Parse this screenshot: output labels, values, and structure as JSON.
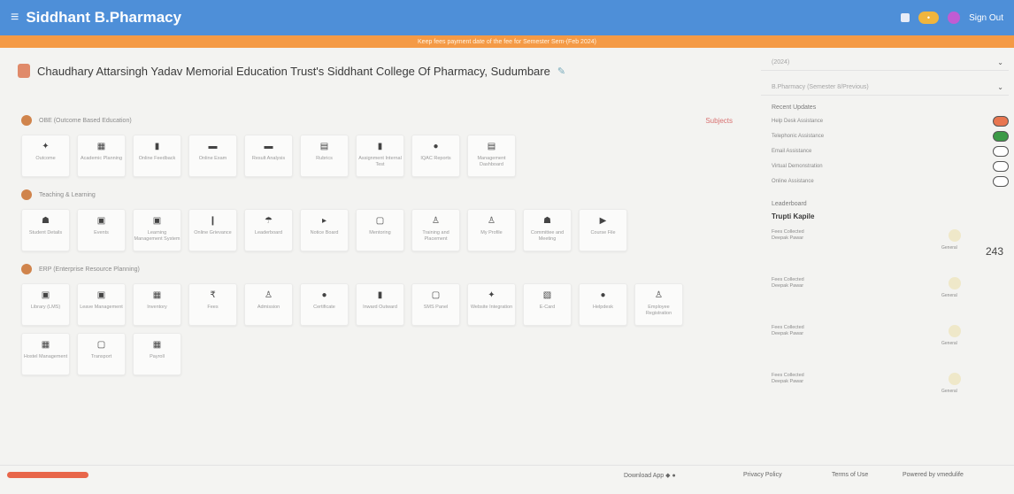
{
  "topbar": {
    "menu_icon": "hamburger-icon",
    "app_name": "Siddhant B.Pharmacy",
    "sign_out": "Sign Out",
    "colors": {
      "bar": "#4e8fd8",
      "banner": "#f49a46"
    }
  },
  "banner": {
    "text": "Keep fees payment date of the fee for Semester Sem-(Feb 2024)"
  },
  "page": {
    "title": "Chaudhary Attarsingh Yadav Memorial Education Trust's Siddhant College Of Pharmacy, Sudumbare",
    "description": ""
  },
  "sections": [
    {
      "title": "OBE (Outcome Based Education)",
      "link": "Subjects",
      "tiles": [
        {
          "label": "Outcome",
          "icon": "✦"
        },
        {
          "label": "Academic Planning",
          "icon": "▦"
        },
        {
          "label": "Online Feedback",
          "icon": "▮"
        },
        {
          "label": "Online Exam",
          "icon": "▬"
        },
        {
          "label": "Result Analysis",
          "icon": "▬"
        },
        {
          "label": "Rubrics",
          "icon": "▤"
        },
        {
          "label": "Assignment Internal Test",
          "icon": "▮"
        },
        {
          "label": "IQAC Reports",
          "icon": "●"
        },
        {
          "label": "Management Dashboard",
          "icon": "▤"
        }
      ]
    },
    {
      "title": "Teaching & Learning",
      "link": "",
      "tiles": [
        {
          "label": "Student Details",
          "icon": "☗"
        },
        {
          "label": "Events",
          "icon": "▣"
        },
        {
          "label": "Learning Management System",
          "icon": "▣"
        },
        {
          "label": "Online Grievance",
          "icon": "❙"
        },
        {
          "label": "Leaderboard",
          "icon": "☂"
        },
        {
          "label": "Notice Board",
          "icon": "▸"
        },
        {
          "label": "Mentoring",
          "icon": "▢"
        },
        {
          "label": "Training and Placement",
          "icon": "♙"
        },
        {
          "label": "My Profile",
          "icon": "♙"
        },
        {
          "label": "Committee and Meeting",
          "icon": "☗"
        },
        {
          "label": "Course File",
          "icon": "▶"
        }
      ]
    },
    {
      "title": "ERP (Enterprise Resource Planning)",
      "link": "",
      "tiles": [
        {
          "label": "Library (LMS)",
          "icon": "▣"
        },
        {
          "label": "Leave Management",
          "icon": "▣"
        },
        {
          "label": "Inventory",
          "icon": "▦"
        },
        {
          "label": "Fees",
          "icon": "₹"
        },
        {
          "label": "Admission",
          "icon": "♙"
        },
        {
          "label": "Certificate",
          "icon": "●"
        },
        {
          "label": "Inward Outward",
          "icon": "▮"
        },
        {
          "label": "SMS Panel",
          "icon": "▢"
        },
        {
          "label": "Website Integration",
          "icon": "✦"
        },
        {
          "label": "E-Card",
          "icon": "▧"
        },
        {
          "label": "Helpdesk",
          "icon": "●"
        },
        {
          "label": "Employee Registration",
          "icon": "♙"
        },
        {
          "label": "Hostel Management",
          "icon": "▦"
        },
        {
          "label": "Transport",
          "icon": "▢"
        },
        {
          "label": "Payroll",
          "icon": "▦"
        }
      ]
    }
  ],
  "sidebar": {
    "selects": [
      {
        "value": "(2024)"
      },
      {
        "value": "B.Pharmacy (Semester 8/Previous)"
      }
    ],
    "recent_updates_title": "Recent Updates",
    "updates": [
      {
        "label": "Help Desk Assistance",
        "color": "#e8754f"
      },
      {
        "label": "Telephonic Assistance",
        "color": "#3c9a46"
      },
      {
        "label": "Email Assistance",
        "color": "#ffffff"
      },
      {
        "label": "Virtual Demonstration",
        "color": "#ffffff"
      },
      {
        "label": "Online Assistance",
        "color": "#ffffff"
      }
    ],
    "leaderboard_title": "Leaderboard",
    "leaderboard_name": "Trupti Kapile",
    "leaderboard_count": "243",
    "fees": [
      {
        "title": "Fees Collected",
        "who": "Deepak Pawar",
        "cat": "General"
      },
      {
        "title": "Fees Collected",
        "who": "Deepak Pawar",
        "cat": "General"
      },
      {
        "title": "Fees Collected",
        "who": "Deepak Pawar",
        "cat": "General"
      },
      {
        "title": "Fees Collected",
        "who": "Deepak Pawar",
        "cat": "General"
      }
    ]
  },
  "footer": {
    "download": "Download App",
    "privacy": "Privacy Policy",
    "terms": "Terms of Use",
    "powered": "Powered by vmedulife"
  }
}
